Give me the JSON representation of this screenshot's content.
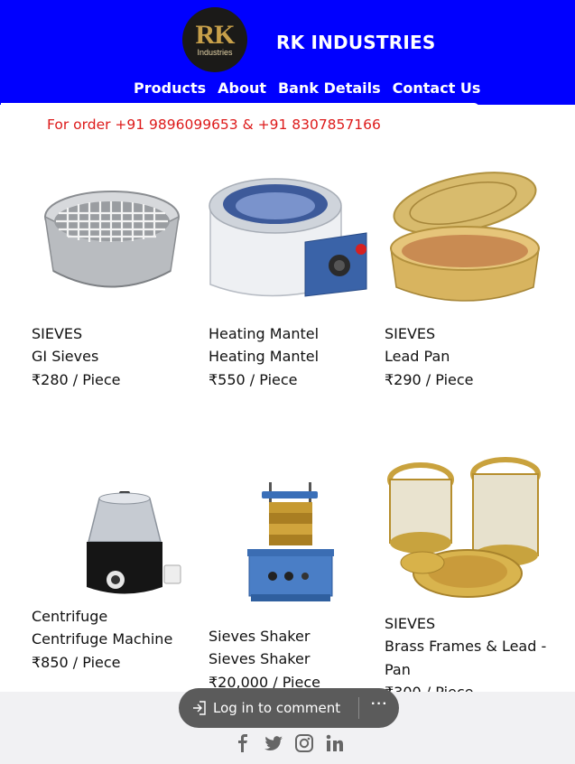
{
  "header": {
    "logo_text": "RK",
    "logo_subtext": "Industries",
    "brand": "RK INDUSTRIES",
    "nav": [
      "Products",
      "About",
      "Bank Details",
      "Contact Us"
    ]
  },
  "order_line": "For order +91 9896099653 & +91 8307857166",
  "products": [
    {
      "category": "SIEVES",
      "name": "GI Sieves",
      "price": "₹280 / Piece"
    },
    {
      "category": "Heating Mantel",
      "name": "Heating Mantel",
      "price": "₹550 / Piece"
    },
    {
      "category": "SIEVES",
      "name": "Lead Pan",
      "price": "₹290 / Piece"
    },
    {
      "category": "Centrifuge",
      "name": "Centrifuge Machine",
      "price": "₹850 / Piece"
    },
    {
      "category": "Sieves Shaker",
      "name": "Sieves Shaker",
      "price": "₹20,000 / Piece"
    },
    {
      "category": "SIEVES",
      "name_line1": "Brass Frames & Lead -",
      "name_line2": "Pan",
      "price": "₹300 / Piece"
    }
  ],
  "comment_bar": {
    "login_label": "Log in to comment",
    "more_label": "···"
  },
  "social": [
    "facebook-icon",
    "twitter-icon",
    "instagram-icon",
    "linkedin-icon"
  ],
  "colors": {
    "header": "#0000ff",
    "order_text": "#dd1a1a",
    "pill": "#5b5b5b"
  }
}
